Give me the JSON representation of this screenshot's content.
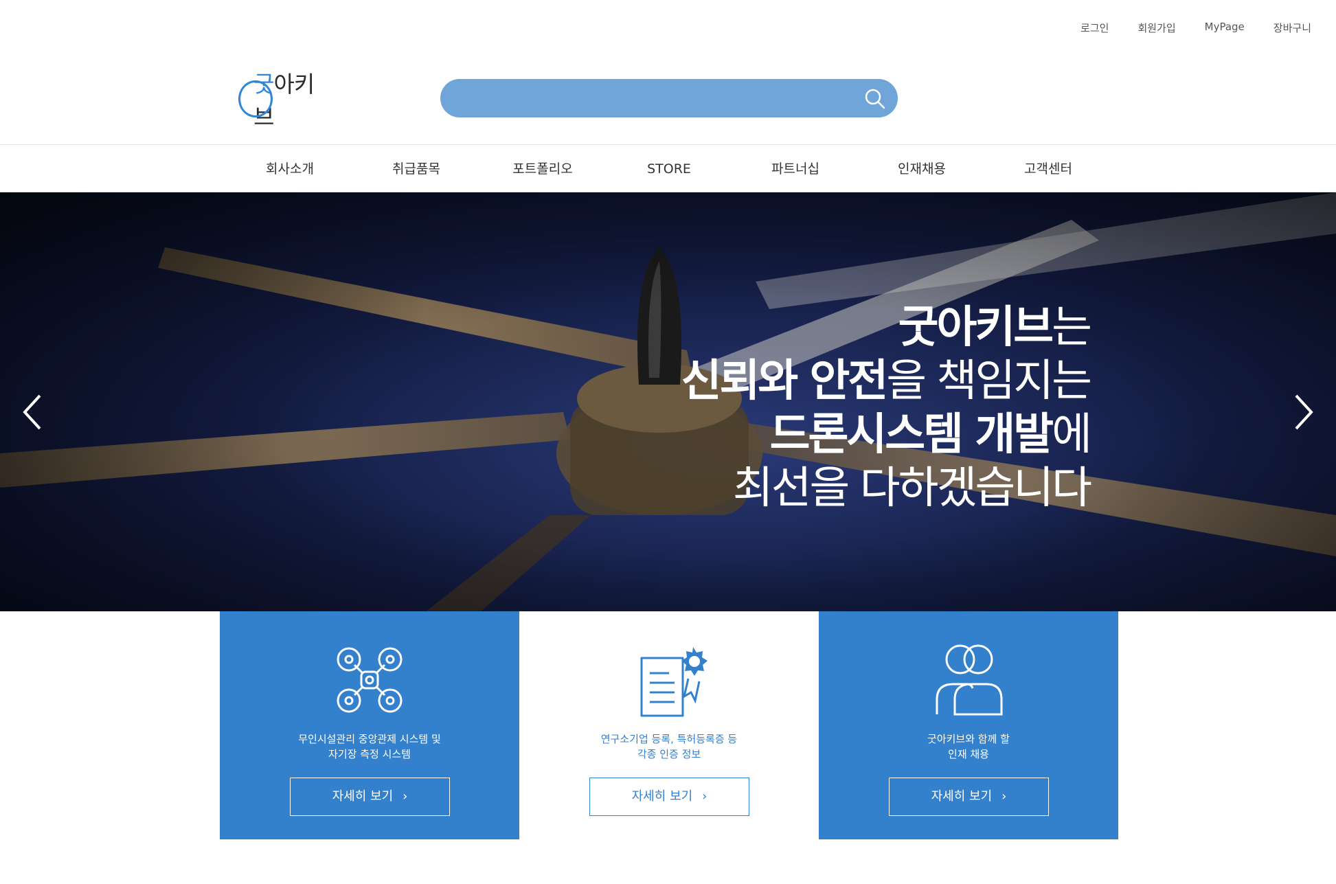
{
  "util_links": [
    "로그인",
    "회원가입",
    "MyPage",
    "장바구니"
  ],
  "logo": {
    "accent": "굿",
    "rest": "아키브"
  },
  "search": {
    "placeholder": ""
  },
  "nav": [
    "회사소개",
    "취급품목",
    "포트폴리오",
    "STORE",
    "파트너십",
    "인재채용",
    "고객센터"
  ],
  "hero": {
    "line1_bold": "굿아키브",
    "line1_rest": "는",
    "line2_bold": "신뢰와 안전",
    "line2_rest": "을 책임지는",
    "line3_bold": "드론시스템 개발",
    "line3_rest": "에",
    "line4": "최선을 다하겠습니다"
  },
  "cards": [
    {
      "icon": "drone-icon",
      "desc1": "무인시설관리 중앙관제 시스템 및",
      "desc2": "자기장 측정 시스템",
      "button": "자세히 보기",
      "style": "blue"
    },
    {
      "icon": "certificate-icon",
      "desc1": "연구소기업 등록, 특허등록증 등",
      "desc2": "각종 인증 정보",
      "button": "자세히 보기",
      "style": "white"
    },
    {
      "icon": "people-icon",
      "desc1": "굿아키브와 함께 할",
      "desc2": "인재 채용",
      "button": "자세히 보기",
      "style": "blue"
    }
  ],
  "colors": {
    "brand_blue": "#3380cc",
    "search_bg": "#6fa5d9"
  }
}
